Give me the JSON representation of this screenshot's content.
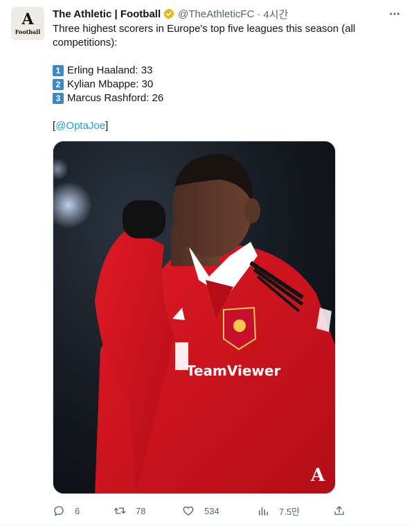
{
  "tweet": {
    "author_name": "The Athletic | Football",
    "handle": "@TheAthleticFC",
    "separator": "·",
    "time": "4시간",
    "avatar": {
      "glyph": "A",
      "label": "Football"
    },
    "verified_color": "#e2b719",
    "intro": "Three highest scorers in Europe's top five leagues this season (all competitions):",
    "rankings": [
      {
        "num": "1",
        "text": "Erling Haaland: 33"
      },
      {
        "num": "2",
        "text": "Kylian Mbappe: 30"
      },
      {
        "num": "3",
        "text": "Marcus Rashford: 26"
      }
    ],
    "source_open": "[",
    "source_link": "@OptaJoe",
    "source_close": "]",
    "media": {
      "kit_sponsor": "TeamViewer",
      "watermark": "A"
    }
  },
  "actions": {
    "replies": "6",
    "retweets": "78",
    "likes": "534",
    "views": "7.5만"
  },
  "colors": {
    "link": "#1d9bf0",
    "muted": "#536471",
    "kit_red": "#d6101c"
  }
}
